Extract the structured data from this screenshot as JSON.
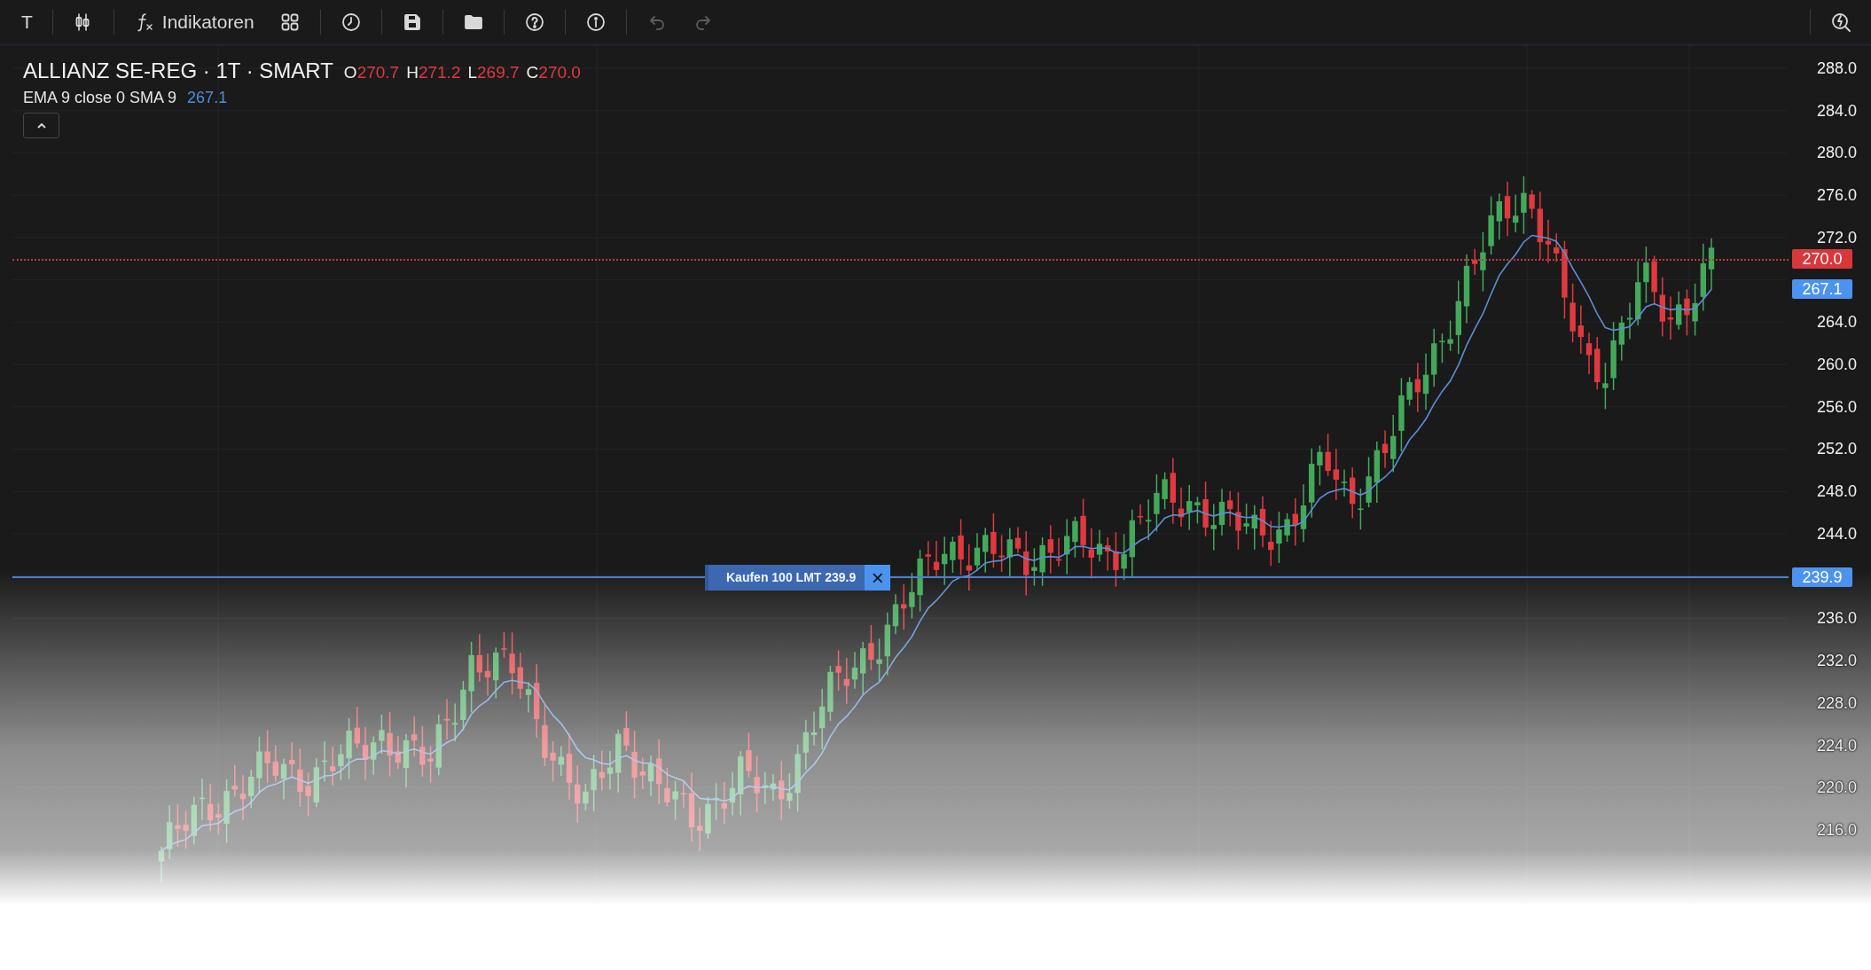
{
  "toolbar": {
    "groups": [
      {
        "items": [
          {
            "kind": "text",
            "label": "T",
            "disabled": false
          }
        ]
      },
      {
        "items": [
          {
            "kind": "chart-type",
            "disabled": false
          }
        ]
      },
      {
        "items": [
          {
            "kind": "indicators",
            "label": "Indikatoren",
            "disabled": false
          },
          {
            "kind": "layout",
            "disabled": false
          }
        ]
      },
      {
        "items": [
          {
            "kind": "clock",
            "disabled": false
          }
        ]
      },
      {
        "items": [
          {
            "kind": "save",
            "disabled": false
          }
        ]
      },
      {
        "items": [
          {
            "kind": "folder",
            "disabled": false
          }
        ]
      },
      {
        "items": [
          {
            "kind": "help",
            "disabled": false
          }
        ]
      },
      {
        "items": [
          {
            "kind": "info",
            "disabled": false
          }
        ]
      },
      {
        "items": [
          {
            "kind": "undo",
            "disabled": true
          },
          {
            "kind": "redo",
            "disabled": true
          }
        ]
      }
    ],
    "right_items": [
      {
        "kind": "quick-search",
        "disabled": false
      }
    ]
  },
  "legend": {
    "symbol": "ALLIANZ SE-REG · 1T · SMART",
    "ohlc": [
      {
        "label": "O",
        "value": "270.7"
      },
      {
        "label": "H",
        "value": "271.2"
      },
      {
        "label": "L",
        "value": "269.7"
      },
      {
        "label": "C",
        "value": "270.0"
      }
    ],
    "indicator": {
      "name": "EMA 9 close 0 SMA 9",
      "value": "267.1"
    },
    "collapsed": false
  },
  "price_axis": {
    "ticks": [
      "288.0",
      "284.0",
      "280.0",
      "276.0",
      "272.0",
      "264.0",
      "260.0",
      "256.0",
      "252.0",
      "248.0",
      "244.0",
      "236.0",
      "232.0",
      "228.0",
      "224.0",
      "220.0",
      "216.0"
    ]
  },
  "markers": [
    {
      "kind": "last",
      "price": "270.0"
    },
    {
      "kind": "indicator",
      "price": "267.1"
    },
    {
      "kind": "order",
      "price": "239.9"
    }
  ],
  "order": {
    "label": "Kaufen 100 LMT 239.9",
    "close": "×"
  }
}
